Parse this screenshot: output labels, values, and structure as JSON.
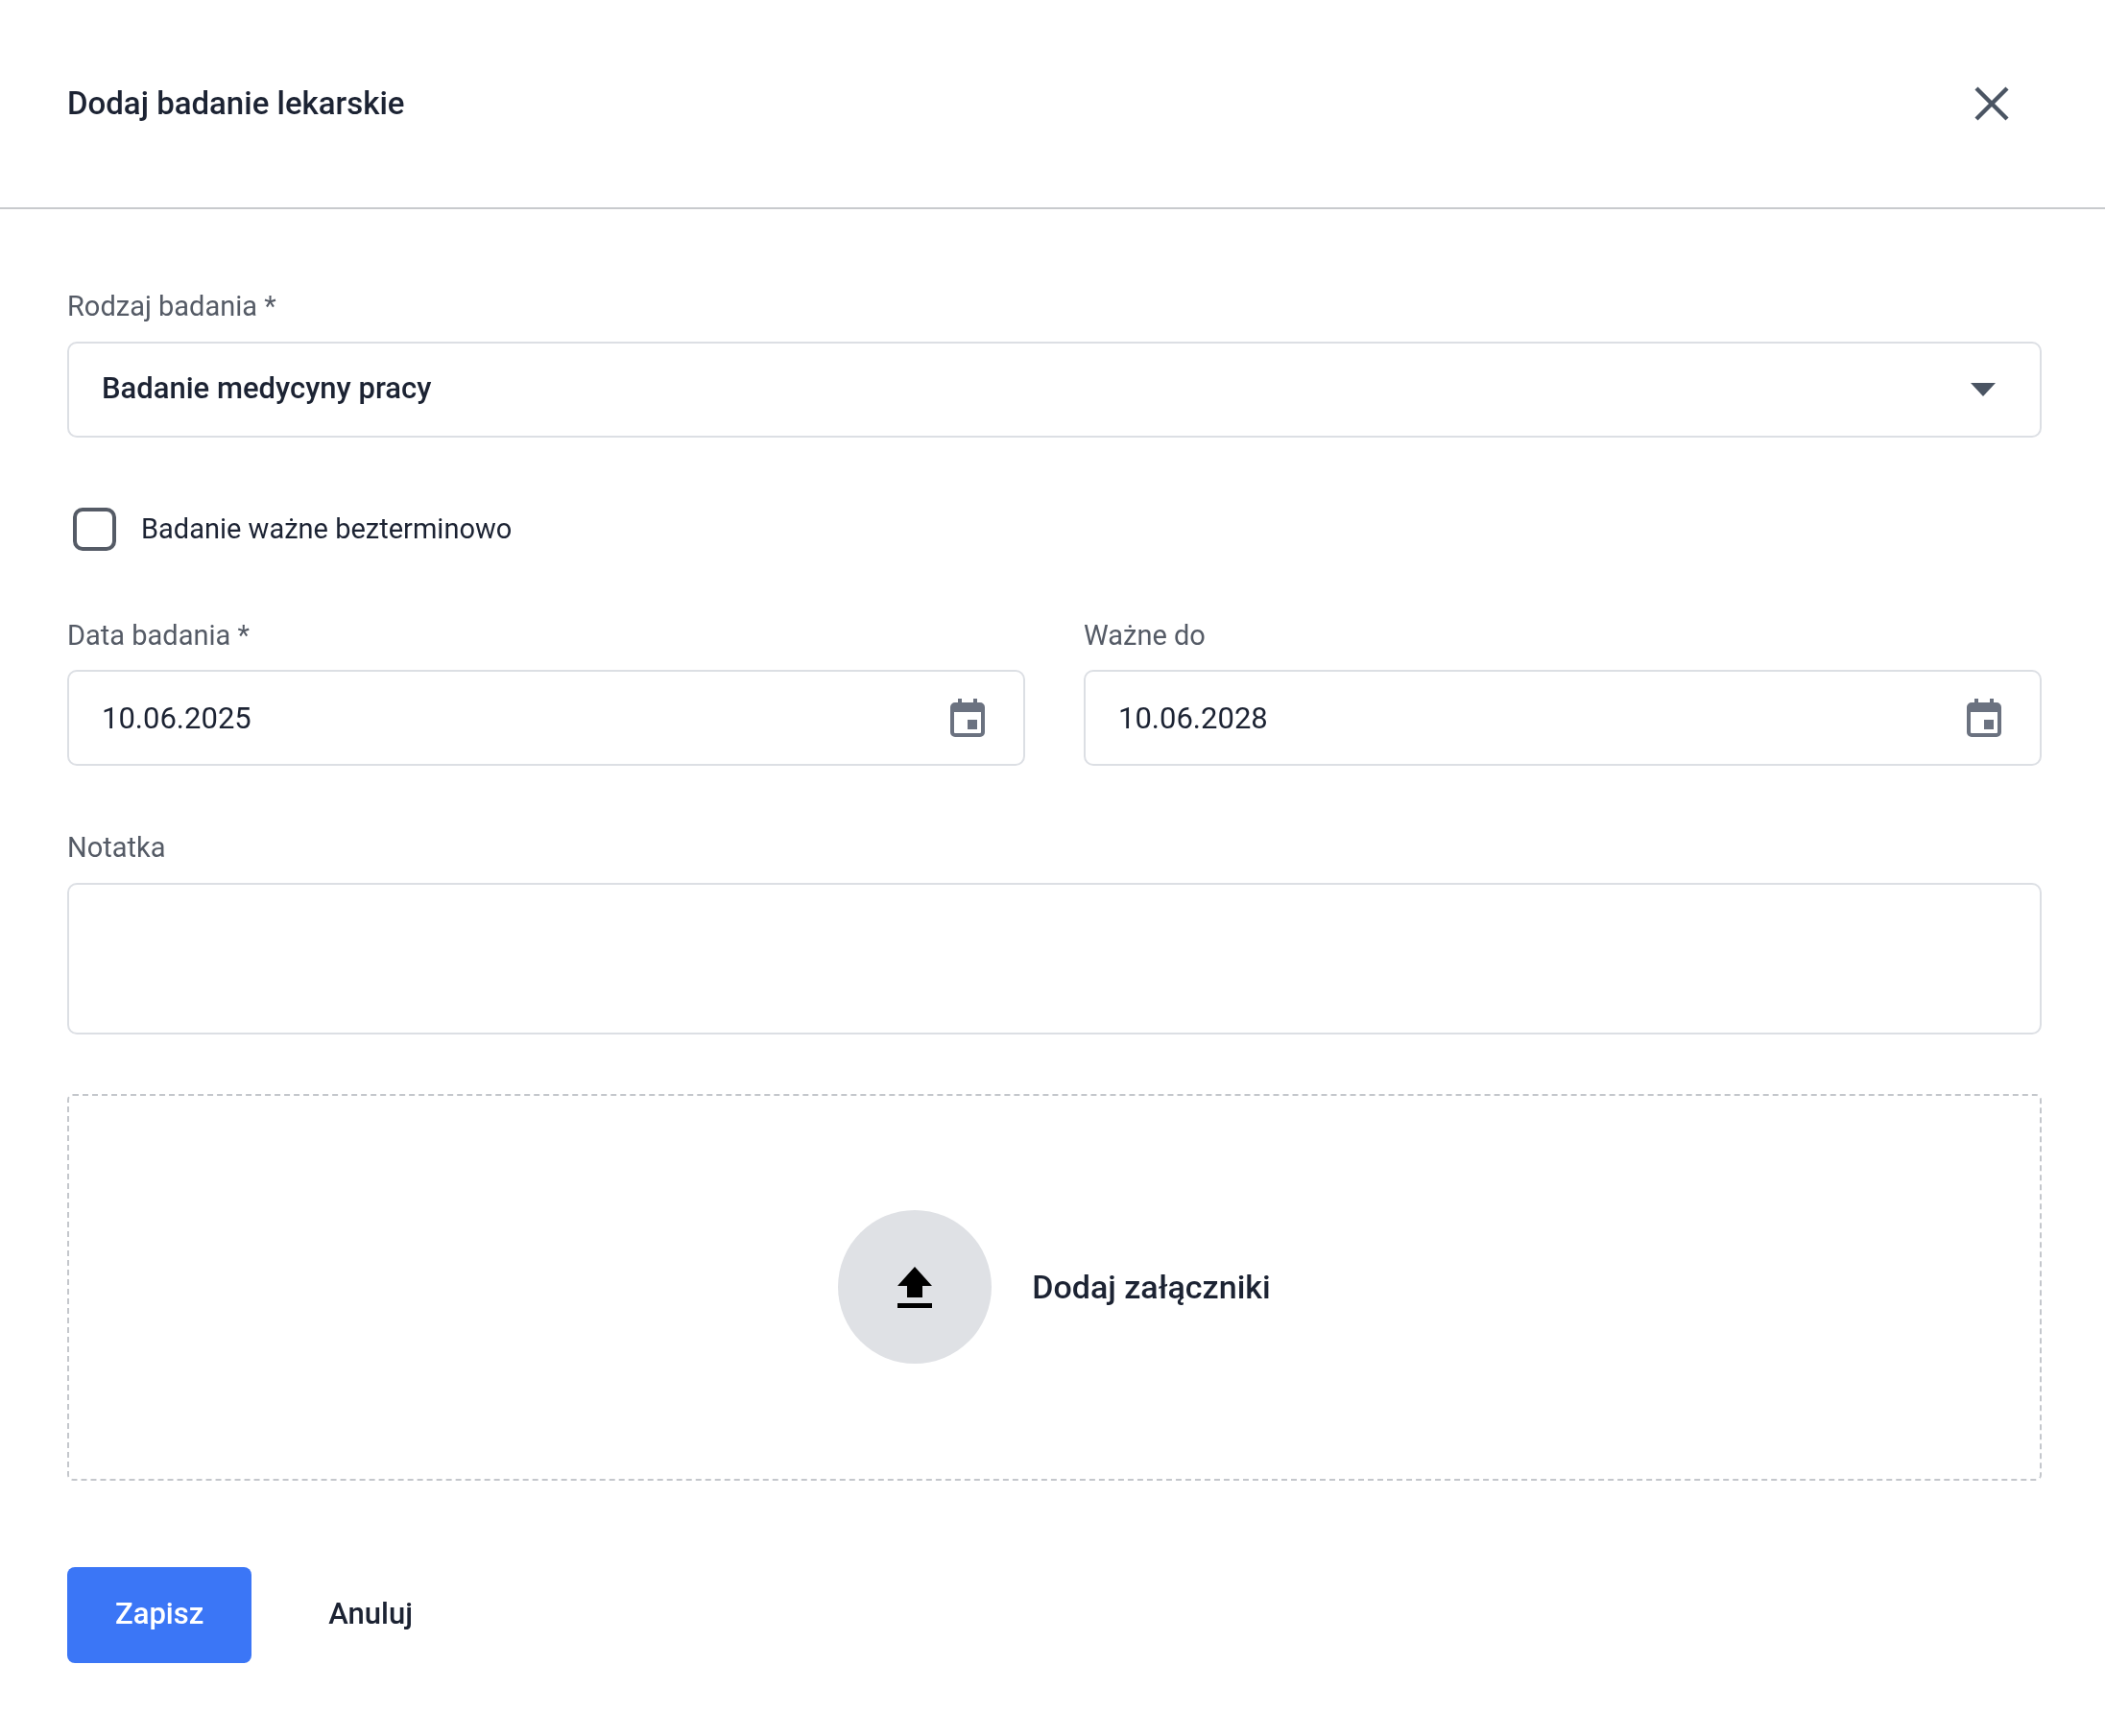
{
  "dialog": {
    "title": "Dodaj badanie lekarskie"
  },
  "exam_type": {
    "label": "Rodzaj badania *",
    "value": "Badanie medycyny pracy"
  },
  "indefinite": {
    "label": "Badanie ważne bezterminowo",
    "checked": false
  },
  "exam_date": {
    "label": "Data badania *",
    "value": "10.06.2025"
  },
  "valid_until": {
    "label": "Ważne do",
    "value": "10.06.2028"
  },
  "note": {
    "label": "Notatka"
  },
  "attachments": {
    "label": "Dodaj załączniki"
  },
  "buttons": [
    {
      "label": "Zapisz",
      "kind": "primary"
    },
    {
      "label": "Anuluj",
      "kind": "text"
    }
  ]
}
